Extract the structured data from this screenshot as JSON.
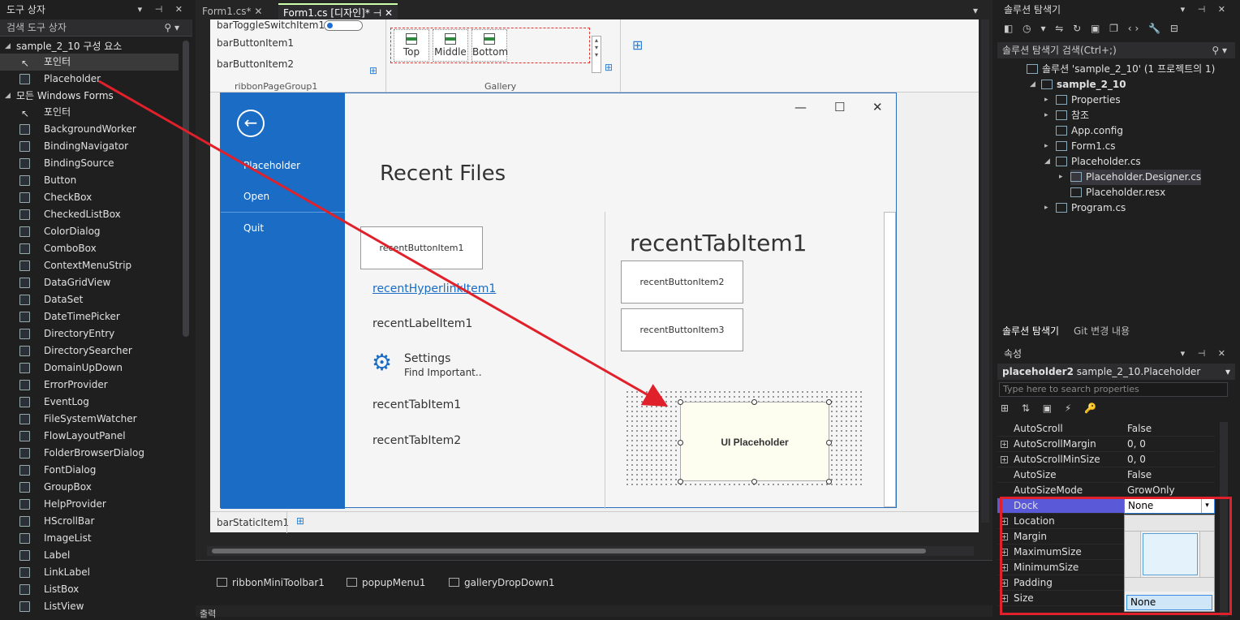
{
  "toolbox": {
    "title": "도구 상자",
    "search_placeholder": "검색 도구 상자",
    "group1": "sample_2_10 구성 요소",
    "group1_items": [
      "포인터",
      "Placeholder"
    ],
    "group2": "모든 Windows Forms",
    "items": [
      "포인터",
      "BackgroundWorker",
      "BindingNavigator",
      "BindingSource",
      "Button",
      "CheckBox",
      "CheckedListBox",
      "ColorDialog",
      "ComboBox",
      "ContextMenuStrip",
      "DataGridView",
      "DataSet",
      "DateTimePicker",
      "DirectoryEntry",
      "DirectorySearcher",
      "DomainUpDown",
      "ErrorProvider",
      "EventLog",
      "FileSystemWatcher",
      "FlowLayoutPanel",
      "FolderBrowserDialog",
      "FontDialog",
      "GroupBox",
      "HelpProvider",
      "HScrollBar",
      "ImageList",
      "Label",
      "LinkLabel",
      "ListBox",
      "ListView"
    ]
  },
  "tabs": [
    {
      "label": "Form1.cs*"
    },
    {
      "label": "Form1.cs [디자인]*"
    }
  ],
  "ribbon": {
    "toggle_item": "barToggleSwitchItem1",
    "button1": "barButtonItem1",
    "button2": "barButtonItem2",
    "group_label": "ribbonPageGroup1",
    "gallery_label": "Gallery",
    "gallery_items": [
      "Top",
      "Middle",
      "Bottom"
    ]
  },
  "backstage": {
    "items": [
      "Placeholder",
      "Open",
      "Quit"
    ],
    "recent_title": "Recent Files",
    "recent_button1": "recentButtonItem1",
    "hyperlink": "recentHyperlinkItem1",
    "label_item": "recentLabelItem1",
    "settings_title": "Settings",
    "settings_sub": "Find Important..",
    "tab1": "recentTabItem1",
    "tab2": "recentTabItem2",
    "tab_header": "recentTabItem1",
    "button2": "recentButtonItem2",
    "button3": "recentButtonItem3",
    "placeholder": "UI Placeholder"
  },
  "statusbar": {
    "item": "barStaticItem1"
  },
  "tray": [
    "ribbonMiniToolbar1",
    "popupMenu1",
    "galleryDropDown1"
  ],
  "output_title": "출력",
  "solution": {
    "title": "솔루션 탐색기",
    "search": "솔루션 탐색기 검색(Ctrl+;)",
    "tree": [
      "솔루션 'sample_2_10' (1 프로젝트의 1)",
      "sample_2_10",
      "Properties",
      "참조",
      "App.config",
      "Form1.cs",
      "Placeholder.cs",
      "Placeholder.Designer.cs",
      "Placeholder.resx",
      "Program.cs"
    ],
    "bottom_tabs": [
      "솔루션 탐색기",
      "Git 변경 내용"
    ]
  },
  "properties": {
    "title": "속성",
    "object_name": "placeholder2",
    "object_type": "sample_2_10.Placeholder",
    "search_placeholder": "Type here to search properties",
    "rows": [
      {
        "name": "AutoScroll",
        "value": "False"
      },
      {
        "name": "AutoScrollMargin",
        "value": "0, 0"
      },
      {
        "name": "AutoScrollMinSize",
        "value": "0, 0"
      },
      {
        "name": "AutoSize",
        "value": "False"
      },
      {
        "name": "AutoSizeMode",
        "value": "GrowOnly"
      },
      {
        "name": "Dock",
        "value": "None"
      },
      {
        "name": "Location",
        "value": ""
      },
      {
        "name": "Margin",
        "value": ""
      },
      {
        "name": "MaximumSize",
        "value": ""
      },
      {
        "name": "MinimumSize",
        "value": ""
      },
      {
        "name": "Padding",
        "value": ""
      },
      {
        "name": "Size",
        "value": ""
      }
    ],
    "dock_option": "None"
  }
}
